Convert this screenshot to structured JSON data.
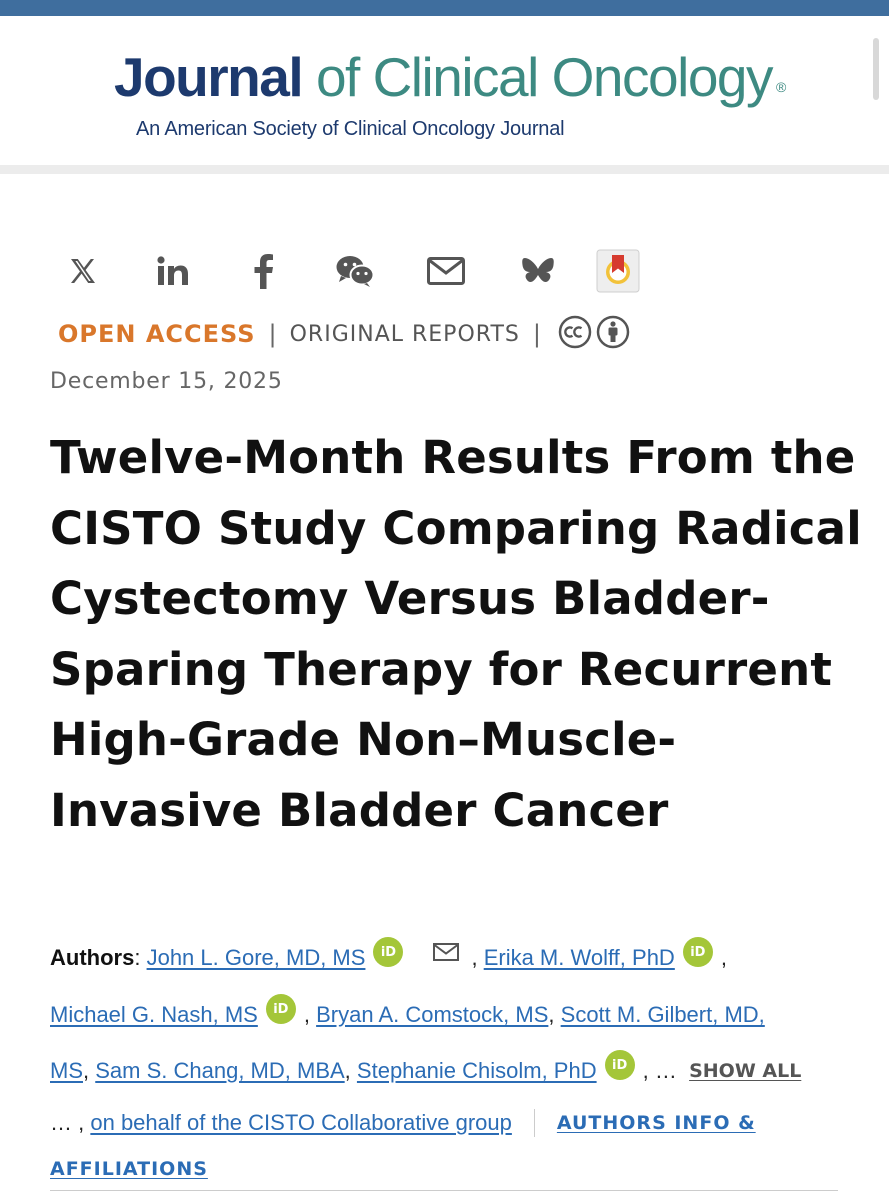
{
  "journal": {
    "name_bold": "Journal",
    "name_rest": "of Clinical Oncology",
    "registered_mark": "®",
    "subtitle": "An American Society of Clinical Oncology Journal"
  },
  "share": {
    "icons": [
      "x-icon",
      "linkedin-icon",
      "facebook-icon",
      "wechat-icon",
      "email-icon",
      "bluesky-icon",
      "mendeley-icon"
    ]
  },
  "article_meta": {
    "access": "OPEN ACCESS",
    "separator": "|",
    "type": "ORIGINAL REPORTS",
    "license_icons": [
      "creative-commons-icon",
      "attribution-icon"
    ],
    "date": "December 15, 2025"
  },
  "title": "Twelve-Month Results From the CISTO Study Comparing Radical Cystectomy Versus Bladder-Sparing Therapy for Recurrent High-Grade Non–Muscle-Invasive Bladder Cancer",
  "authors": {
    "label": "Authors",
    "colon": ":",
    "list": [
      "John L. Gore, MD, MS",
      "Erika M. Wolff, PhD",
      "Michael G. Nash, MS",
      "Bryan A. Comstock, MS",
      "Scott M. Gilbert, MD,",
      "MS",
      "Sam S. Chang, MD, MBA",
      "Stephanie Chisolm, PhD"
    ],
    "orcid_label": "iD",
    "comma": ",",
    "ellipsis_comma": ", …",
    "show_all": "SHOW ALL",
    "leading_ellipsis": "… ,",
    "group": "on behalf of the CISTO Collaborative group",
    "info_line1": "AUTHORS INFO &",
    "info_line2": "AFFILIATIONS"
  },
  "colors": {
    "top_bar": "#3f6e9e",
    "journal_navy": "#1d3a6e",
    "journal_teal": "#3d8a82",
    "open_access": "#d9772b",
    "link_blue": "#2b6cb5",
    "orcid_green": "#a4c639"
  }
}
